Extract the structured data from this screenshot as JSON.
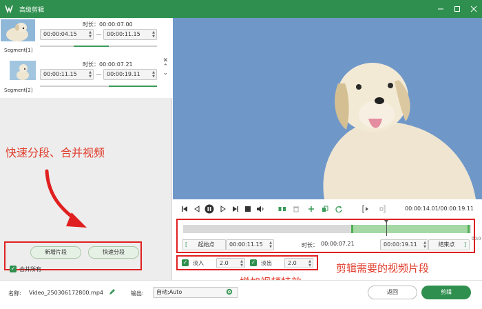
{
  "window": {
    "title": "高级剪辑"
  },
  "segments": [
    {
      "label": "Segment[1]",
      "duration": "时长：00:00:07.00",
      "start": "00:00:04.15",
      "end": "00:00:11.15",
      "fill_start": 0.29,
      "fill_end": 0.59
    },
    {
      "label": "Segment[2]",
      "duration": "时长：00:00:07.21",
      "start": "00:00:11.15",
      "end": "00:00:19.11",
      "fill_start": 0.59,
      "fill_end": 1.0
    }
  ],
  "annotations": {
    "left": "快速分段、合并视频",
    "effects": "增加视频特效",
    "clip": "剪辑需要的视频片段"
  },
  "left_actions": {
    "new_segment": "新增片段",
    "quick_split": "快速分段",
    "merge_all": "合并所有"
  },
  "playback": {
    "current_total": "00:00:14.01/00:00:19.11"
  },
  "timeline": {
    "start_label": "起始点",
    "start_time": "00:00:11.15",
    "duration_label": "时长：",
    "duration": "00:00:07.21",
    "end_time": "00:00:19.11",
    "end_label": "结束点",
    "edge_tip": "00:0",
    "selection_start": 0.58,
    "selection_end": 1.0,
    "playhead": 0.7
  },
  "effects": {
    "fade_in_label": "淡入",
    "fade_in": "2.0",
    "fade_out_label": "淡出",
    "fade_out": "2.0"
  },
  "footer": {
    "name_label": "名称:",
    "name": "Video_250306172800.mp4",
    "output_label": "输出:",
    "output": "自动;Auto",
    "back": "返回",
    "clip": "剪辑"
  },
  "colors": {
    "brand": "#2f8f4e",
    "annotation": "#e03b2a",
    "preview_bg": "#6a94c8"
  }
}
